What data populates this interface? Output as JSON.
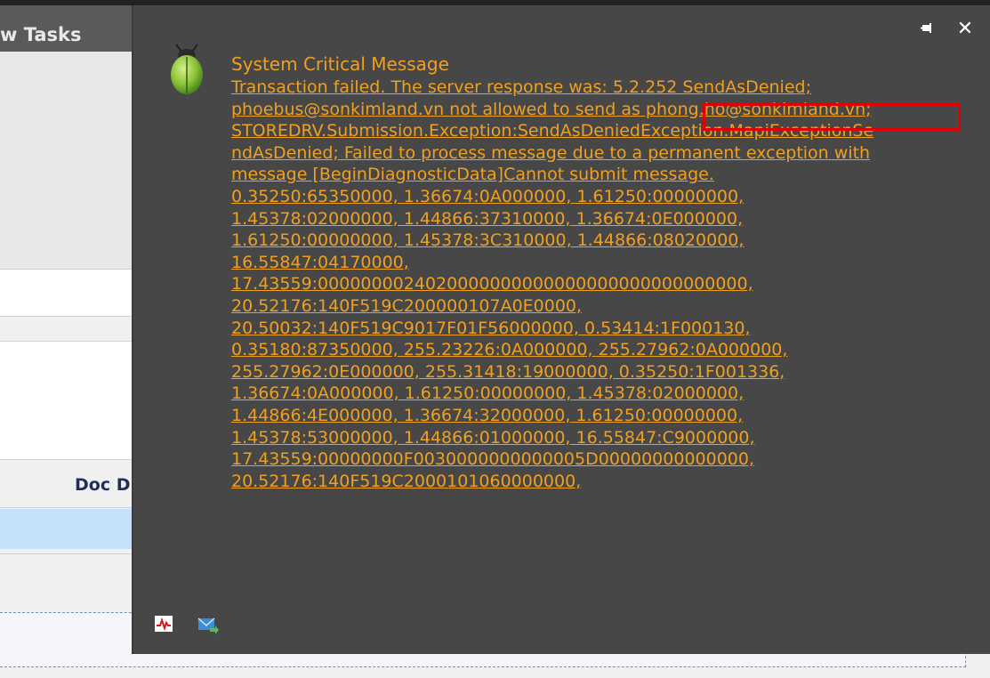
{
  "background": {
    "header_title": "w Tasks",
    "column_label": "Doc D"
  },
  "popup": {
    "pin_icon": "pin-icon",
    "close_icon": "close-icon",
    "app_icon": "bug-icon",
    "title": "System Critical Message",
    "message_lines": [
      "Transaction failed. The server response was: 5.2.252 SendAsDenied;",
      "phoebus@sonkimland.vn not allowed to send as phong.ho@sonkimland.vn;",
      "STOREDRV.Submission.Exception:SendAsDeniedException.MapiExceptionSe",
      "ndAsDenied; Failed to process message due to a permanent exception with",
      "message [BeginDiagnosticData]Cannot submit message.",
      "0.35250:65350000, 1.36674:0A000000, 1.61250:00000000,",
      "1.45378:02000000, 1.44866:37310000, 1.36674:0E000000,",
      "1.61250:00000000, 1.45378:3C310000, 1.44866:08020000,",
      "16.55847:04170000,",
      "17.43559:0000000024020000000000000000000000000000,",
      "20.52176:140F519C200000107A0E0000,",
      "20.50032:140F519C9017F01F56000000, 0.53414:1F000130,",
      "0.35180:87350000, 255.23226:0A000000, 255.27962:0A000000,",
      "255.27962:0E000000, 255.31418:19000000, 0.35250:1F001336,",
      "1.36674:0A000000, 1.61250:00000000, 1.45378:02000000,",
      "1.44866:4E000000, 1.36674:32000000, 1.61250:00000000,",
      "1.45378:53000000, 1.44866:01000000, 16.55847:C9000000,",
      "17.43559:00000000F0030000000000005D00000000000000,",
      "20.52176:140F519C2000101060000000,"
    ],
    "highlighted_text": "phong.ho@sonkimland.vn",
    "footer_icons": [
      "chart-icon",
      "mail-icon"
    ],
    "colors": {
      "background": "#474747",
      "message_text": "#f0a020",
      "highlight_box": "#e00000"
    }
  }
}
